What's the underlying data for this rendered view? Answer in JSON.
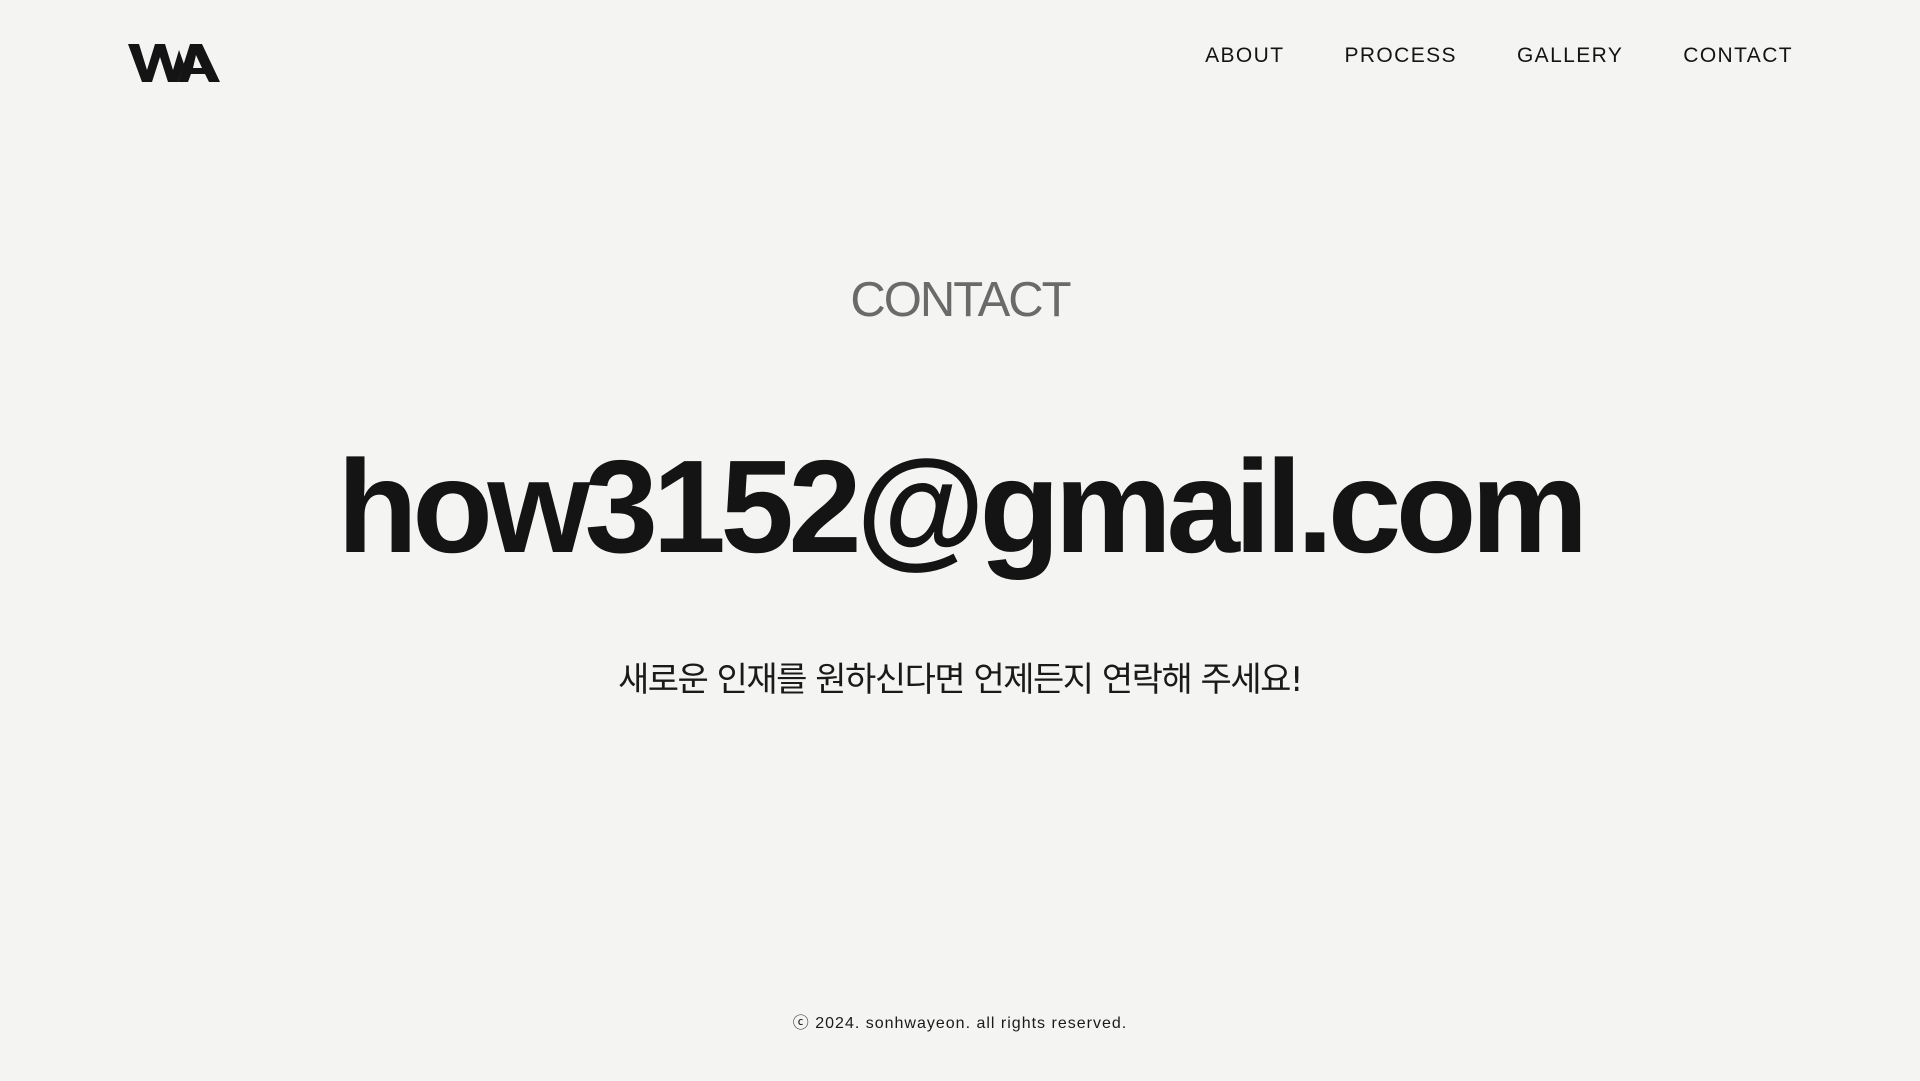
{
  "header": {
    "logo_text": "WA",
    "nav": [
      {
        "label": "ABOUT"
      },
      {
        "label": "PROCESS"
      },
      {
        "label": "GALLERY"
      },
      {
        "label": "CONTACT"
      }
    ]
  },
  "main": {
    "section_title": "CONTACT",
    "email": "how3152@gmail.com",
    "tagline": "새로운 인재를 원하신다면 언제든지 연락해 주세요!"
  },
  "footer": {
    "copyright": "ⓒ 2024. sonhwayeon. all rights reserved."
  },
  "colors": {
    "background": "#f4f4f2",
    "text": "#141414",
    "title_gray": "#6a6a6a"
  }
}
